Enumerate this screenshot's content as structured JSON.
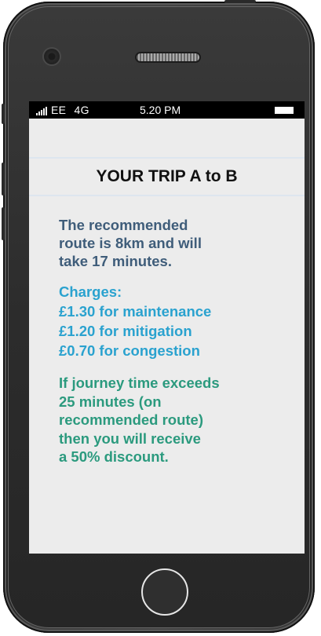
{
  "status_bar": {
    "carrier": "EE",
    "network": "4G",
    "time": "5.20 PM"
  },
  "trip": {
    "title": "YOUR TRIP A to B",
    "summary_lines": [
      "The recommended",
      "route is 8km and will",
      "take 17 minutes."
    ],
    "charges_header": "Charges:",
    "charges": [
      "£1.30 for maintenance",
      "£1.20 for mitigation",
      "£0.70 for congestion"
    ],
    "discount_lines": [
      "If journey time exceeds",
      "25 minutes (on",
      "recommended route)",
      "then you will receive",
      "a 50% discount."
    ]
  },
  "colors": {
    "summary_text": "#3f5d7a",
    "charges_text": "#2aa2cf",
    "discount_text": "#2b9a7e",
    "screen_bg": "#ececec",
    "phone_body": "#3a3a3a"
  },
  "icons": [
    "signal-icon",
    "battery-icon",
    "camera-icon",
    "speaker-icon",
    "home-button-icon"
  ]
}
